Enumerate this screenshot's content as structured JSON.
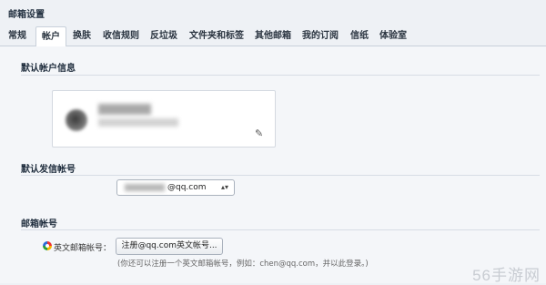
{
  "window": {
    "title": "邮箱设置"
  },
  "tabs": [
    {
      "label": "常规"
    },
    {
      "label": "帐户"
    },
    {
      "label": "换肤"
    },
    {
      "label": "收信规则"
    },
    {
      "label": "反垃圾"
    },
    {
      "label": "文件夹和标签"
    },
    {
      "label": "其他邮箱"
    },
    {
      "label": "我的订阅"
    },
    {
      "label": "信纸"
    },
    {
      "label": "体验室"
    }
  ],
  "active_tab": "帐户",
  "default_account": {
    "heading": "默认帐户信息",
    "edit_icon": "pencil-icon"
  },
  "default_sender": {
    "heading": "默认发信帐号",
    "selected_suffix": "@qq.com",
    "select_arrows": "▴▾"
  },
  "mailbox_account": {
    "heading": "邮箱帐号",
    "row_label": "英文邮箱帐号：",
    "register_button": "注册@qq.com英文帐号...",
    "hint": "(你还可以注册一个英文邮箱帐号，例如：chen@qq.com，并以此登录。)",
    "icon": "qq-logo-icon"
  },
  "watermark": "56手游网"
}
